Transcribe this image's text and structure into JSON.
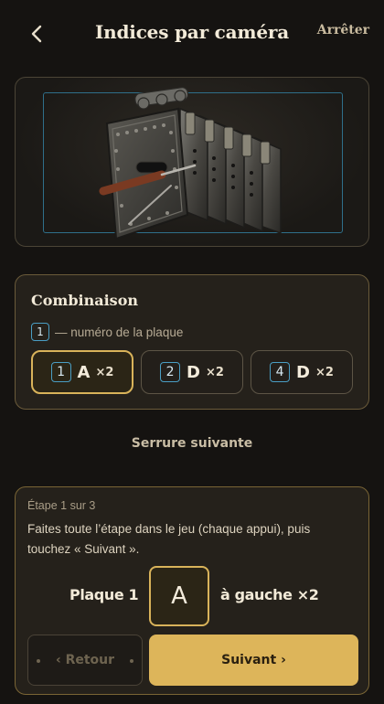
{
  "header": {
    "title": "Indices par caméra",
    "stop_label": "Arrêter"
  },
  "combination": {
    "title": "Combinaison",
    "legend_number": "1",
    "legend_text": "— numéro de la plaque",
    "chips": [
      {
        "number": "1",
        "letter": "A",
        "count": "×2",
        "active": true
      },
      {
        "number": "2",
        "letter": "D",
        "count": "×2",
        "active": false
      },
      {
        "number": "4",
        "letter": "D",
        "count": "×2",
        "active": false
      }
    ]
  },
  "next_lock_label": "Serrure suivante",
  "step": {
    "counter": "Étape 1 sur 3",
    "instruction": "Faites toute l’étape dans le jeu (chaque appui), puis touchez « Suivant ».",
    "plaque_label": "Plaque 1",
    "letter": "A",
    "direction": "à gauche ×2",
    "back_label": "‹ Retour",
    "next_label": "Suivant ›"
  },
  "colors": {
    "accent_gold": "#d9b35a",
    "number_blue": "#4a9ec4",
    "background": "#151311"
  }
}
